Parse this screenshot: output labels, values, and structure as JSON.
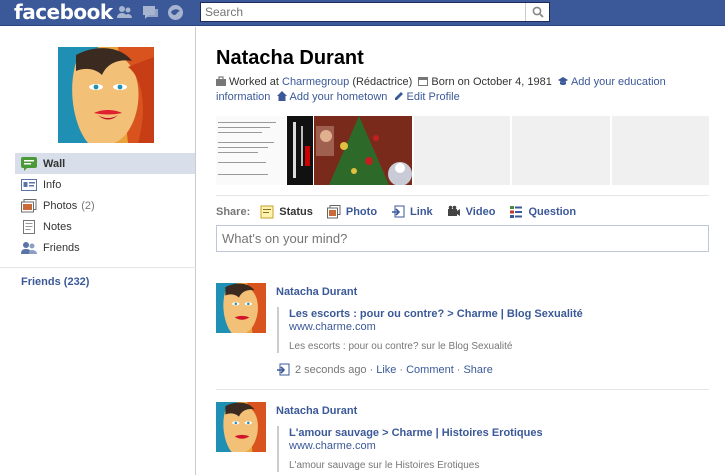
{
  "topbar": {
    "logo": "facebook",
    "search_placeholder": "Search",
    "jewels": [
      "friends-icon",
      "messages-icon",
      "notifications-icon"
    ]
  },
  "profile": {
    "name": "Natacha Durant",
    "worked_prefix": "Worked at",
    "employer": "Charmegroup",
    "role": "(Rédactrice)",
    "born": "Born on October 4, 1981",
    "add_education": "Add your education information",
    "add_hometown": "Add your hometown",
    "edit_profile": "Edit Profile"
  },
  "sidebar": {
    "items": [
      {
        "label": "Wall",
        "icon": "wall-icon",
        "count": ""
      },
      {
        "label": "Info",
        "icon": "info-icon",
        "count": ""
      },
      {
        "label": "Photos",
        "icon": "photos-icon",
        "count": "(2)"
      },
      {
        "label": "Notes",
        "icon": "notes-icon",
        "count": ""
      },
      {
        "label": "Friends",
        "icon": "friends-icon",
        "count": ""
      }
    ],
    "friends_link": "Friends (232)"
  },
  "share": {
    "label": "Share:",
    "options": [
      {
        "label": "Status",
        "icon": "status-icon"
      },
      {
        "label": "Photo",
        "icon": "photo-icon"
      },
      {
        "label": "Link",
        "icon": "link-icon"
      },
      {
        "label": "Video",
        "icon": "video-icon"
      },
      {
        "label": "Question",
        "icon": "question-icon"
      }
    ],
    "placeholder": "What's on your mind?"
  },
  "stories": [
    {
      "author": "Natacha Durant",
      "title": "Les escorts : pour ou contre? > Charme | Blog Sexualité",
      "url": "www.charme.com",
      "desc": "Les escorts : pour ou contre? sur le Blog Sexualité",
      "time": "2 seconds ago",
      "like": "Like",
      "comment": "Comment",
      "share": "Share"
    },
    {
      "author": "Natacha Durant",
      "title": "L'amour sauvage > Charme | Histoires Erotiques",
      "url": "www.charme.com",
      "desc": "L'amour sauvage sur le Histoires Erotiques"
    }
  ],
  "colors": {
    "brand": "#3b5998",
    "nav_active": "#d8dfea",
    "muted": "#777777"
  }
}
